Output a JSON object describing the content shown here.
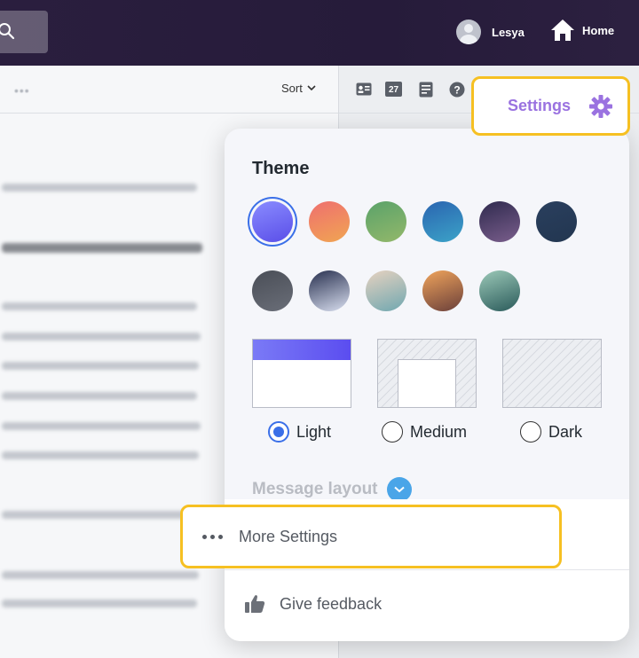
{
  "topbar": {
    "search_icon": "search-icon",
    "user_name": "Lesya",
    "home_label": "Home"
  },
  "message_list": {
    "more_icon": "more-horizontal-icon",
    "sort_label": "Sort"
  },
  "reading_toolbar": {
    "calendar_day": "27",
    "icons": [
      "contact-card-icon",
      "calendar-icon",
      "notepad-icon",
      "help-icon"
    ]
  },
  "settings_tab": {
    "label": "Settings",
    "icon": "gear-icon"
  },
  "theme": {
    "title": "Theme",
    "selected_index": 0,
    "swatches": [
      {
        "name": "purple",
        "colors": [
          "#8a8cff",
          "#5a4ee8"
        ]
      },
      {
        "name": "sunset",
        "colors": [
          "#ef6f6f",
          "#f0a552"
        ]
      },
      {
        "name": "green",
        "colors": [
          "#5aa26a",
          "#93b86a"
        ]
      },
      {
        "name": "ocean",
        "colors": [
          "#2a64b0",
          "#3ca3c8"
        ]
      },
      {
        "name": "dusk",
        "colors": [
          "#2f2a4e",
          "#7a5e8c"
        ]
      },
      {
        "name": "navy",
        "colors": [
          "#2a3f5e",
          "#223650"
        ]
      },
      {
        "name": "charcoal",
        "colors": [
          "#4a4e57",
          "#6a6e78"
        ]
      },
      {
        "name": "mountains",
        "colors": [
          "#28304f",
          "#d9dff0"
        ]
      },
      {
        "name": "camper",
        "colors": [
          "#e7d2c0",
          "#6fa7b0"
        ]
      },
      {
        "name": "desert",
        "colors": [
          "#f0a45c",
          "#6a3f3a"
        ]
      },
      {
        "name": "lake",
        "colors": [
          "#9cc9b8",
          "#2a5a5a"
        ]
      }
    ],
    "modes": [
      {
        "label": "Light",
        "selected": true
      },
      {
        "label": "Medium",
        "selected": false
      },
      {
        "label": "Dark",
        "selected": false
      }
    ]
  },
  "message_layout": {
    "label": "Message layout"
  },
  "more_settings": {
    "label": "More Settings"
  },
  "feedback": {
    "label": "Give feedback",
    "icon": "thumbs-up-icon"
  }
}
